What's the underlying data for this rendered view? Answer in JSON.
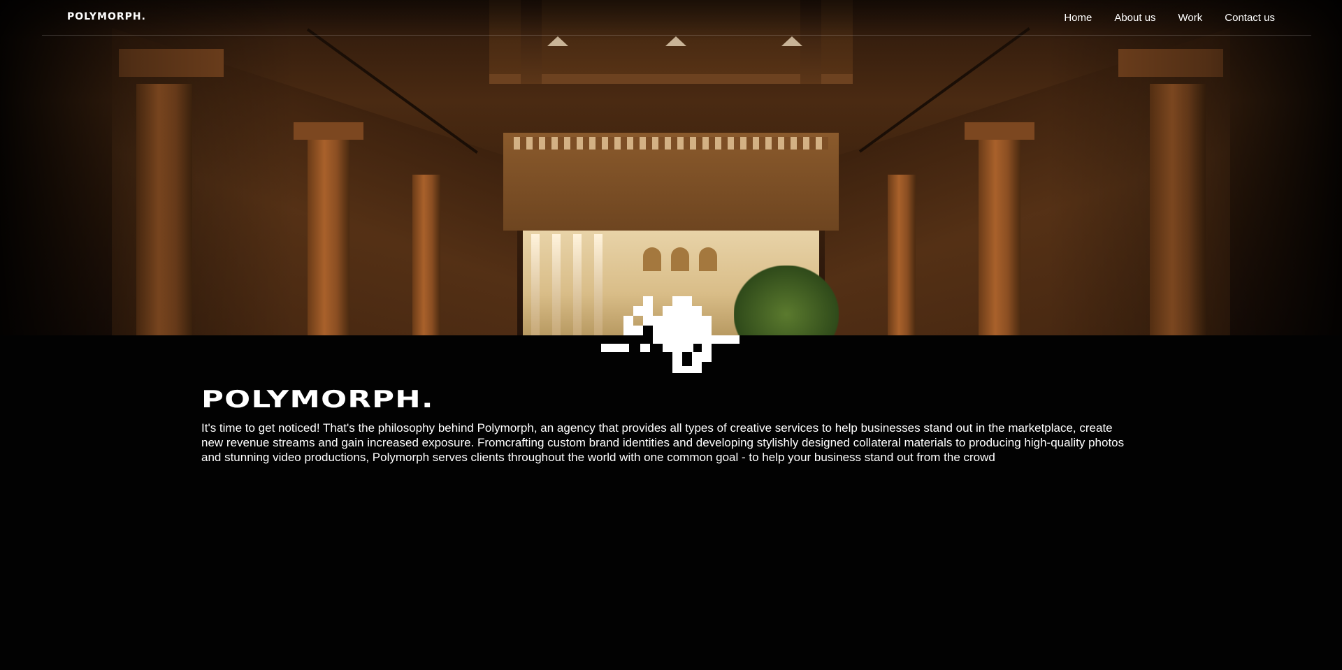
{
  "header": {
    "logo": "POLYMORPH.",
    "nav": [
      {
        "label": "Home"
      },
      {
        "label": "About us"
      },
      {
        "label": "Work"
      },
      {
        "label": "Contact us"
      }
    ]
  },
  "hero": {
    "image": "courtyard-colonnade-photo",
    "mark_icon": "pixel-chameleon-icon"
  },
  "intro": {
    "title": "POLYMORPH.",
    "body": "It's time to get noticed! That's the philosophy behind Polymorph, an agency that provides all types of creative services to help businesses stand out in the marketplace, create new revenue streams and gain increased exposure. Fromcrafting custom brand identities and developing stylishly designed collateral materials to producing high-quality photos and stunning video productions, Polymorph serves clients throughout the world with one common goal - to help your business stand out from the crowd"
  },
  "colors": {
    "background": "#020202",
    "text": "#ffffff",
    "accent": "#a9612b"
  }
}
